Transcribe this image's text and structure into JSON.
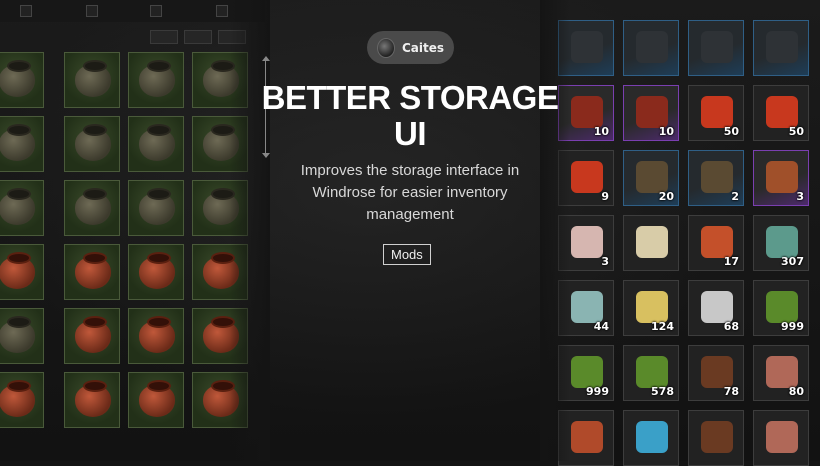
{
  "author": {
    "name": "Caites"
  },
  "title": "BETTER STORAGE UI",
  "description": "Improves the storage interface in Windrose for easier inventory management",
  "tag": "Mods",
  "left_grid": {
    "rows": [
      [
        "green-pot",
        "green-pot",
        "green-pot",
        "green-pot"
      ],
      [
        "green-pot",
        "green-pot",
        "green-pot",
        "green-pot"
      ],
      [
        "green-pot",
        "green-pot",
        "green-pot",
        "green-pot"
      ],
      [
        "red-pot",
        "red-pot",
        "red-pot",
        "red-pot"
      ],
      [
        "green-pot",
        "red-pot",
        "red-pot",
        "red-pot"
      ],
      [
        "red-pot",
        "red-pot",
        "red-pot",
        "red-pot"
      ]
    ]
  },
  "right_grid": {
    "slots": [
      {
        "icon": "dark-cloth",
        "qty": "",
        "rarity": "blue"
      },
      {
        "icon": "dark-cloth",
        "qty": "",
        "rarity": "blue"
      },
      {
        "icon": "dark-cloth",
        "qty": "",
        "rarity": "blue"
      },
      {
        "icon": "dark-cloth",
        "qty": "",
        "rarity": "blue"
      },
      {
        "icon": "red-bottle",
        "qty": "10",
        "rarity": "purple"
      },
      {
        "icon": "red-bottle",
        "qty": "10",
        "rarity": "purple"
      },
      {
        "icon": "chili-pepper",
        "qty": "50",
        "rarity": "plain"
      },
      {
        "icon": "chili-pepper",
        "qty": "50",
        "rarity": "plain"
      },
      {
        "icon": "chili-pepper",
        "qty": "9",
        "rarity": "plain"
      },
      {
        "icon": "green-bottle",
        "qty": "20",
        "rarity": "blue"
      },
      {
        "icon": "green-bottle",
        "qty": "2",
        "rarity": "blue"
      },
      {
        "icon": "cooked-meal",
        "qty": "3",
        "rarity": "purple"
      },
      {
        "icon": "seashell",
        "qty": "3",
        "rarity": "plain"
      },
      {
        "icon": "seed-pack",
        "qty": "",
        "rarity": "plain"
      },
      {
        "icon": "red-ore",
        "qty": "17",
        "rarity": "plain"
      },
      {
        "icon": "teal-stone",
        "qty": "307",
        "rarity": "plain"
      },
      {
        "icon": "egg",
        "qty": "44",
        "rarity": "plain"
      },
      {
        "icon": "yellow-powder",
        "qty": "124",
        "rarity": "plain"
      },
      {
        "icon": "feather",
        "qty": "68",
        "rarity": "plain"
      },
      {
        "icon": "green-fiber",
        "qty": "999",
        "rarity": "plain"
      },
      {
        "icon": "green-fiber",
        "qty": "999",
        "rarity": "plain"
      },
      {
        "icon": "green-fiber",
        "qty": "578",
        "rarity": "plain"
      },
      {
        "icon": "wood-scraps",
        "qty": "78",
        "rarity": "plain"
      },
      {
        "icon": "meat-leg",
        "qty": "80",
        "rarity": "plain"
      },
      {
        "icon": "red-item",
        "qty": "",
        "rarity": "plain"
      },
      {
        "icon": "blue-flower",
        "qty": "",
        "rarity": "plain"
      },
      {
        "icon": "wood-scraps",
        "qty": "",
        "rarity": "plain"
      },
      {
        "icon": "meat-leg",
        "qty": "",
        "rarity": "plain"
      }
    ]
  },
  "item_colors": {
    "dark-cloth": "#2e3236",
    "red-bottle": "#8a2a1c",
    "chili-pepper": "#c8381e",
    "green-bottle": "#5a4a32",
    "cooked-meal": "#a0502a",
    "seashell": "#d6b6b0",
    "seed-pack": "#d8cca8",
    "red-ore": "#c4502a",
    "teal-stone": "#5c9a8c",
    "egg": "#8ab4b2",
    "yellow-powder": "#d8c060",
    "feather": "#c8c8c8",
    "green-fiber": "#5a8a2a",
    "wood-scraps": "#6a3a22",
    "meat-leg": "#b06858",
    "red-item": "#b04a2a",
    "blue-flower": "#3aa0c8"
  }
}
